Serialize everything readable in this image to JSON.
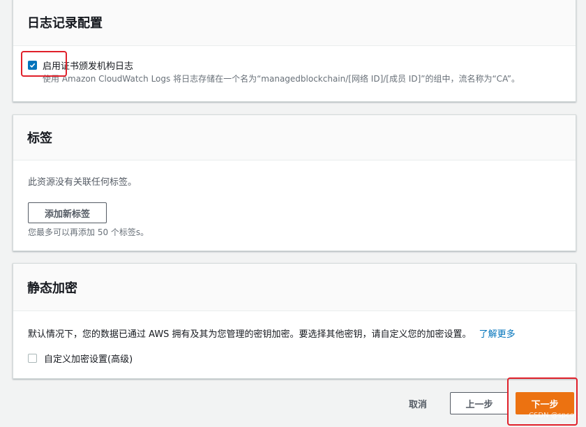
{
  "logging": {
    "title": "日志记录配置",
    "checkbox_label": "启用证书颁发机构日志",
    "checkbox_checked": true,
    "description": "使用 Amazon CloudWatch Logs 将日志存储在一个名为“managedblockchain/[网络 ID]/[成员 ID]”的组中，流名称为“CA”。"
  },
  "tags": {
    "title": "标签",
    "empty_text": "此资源没有关联任何标签。",
    "add_button": "添加新标签",
    "hint": "您最多可以再添加 50 个标签s。"
  },
  "encryption": {
    "title": "静态加密",
    "description": "默认情况下，您的数据已通过 AWS 拥有及其为您管理的密钥加密。要选择其他密钥，请自定义您的加密设置。",
    "learn_more": "了解更多",
    "custom_checkbox_label": "自定义加密设置(高级)",
    "custom_checkbox_checked": false
  },
  "footer": {
    "cancel": "取消",
    "previous": "上一步",
    "next": "下一步"
  },
  "watermark": "CSDN @spcoft",
  "colors": {
    "primary": "#ec7211",
    "link": "#0073bb",
    "highlight": "#e0202a"
  }
}
